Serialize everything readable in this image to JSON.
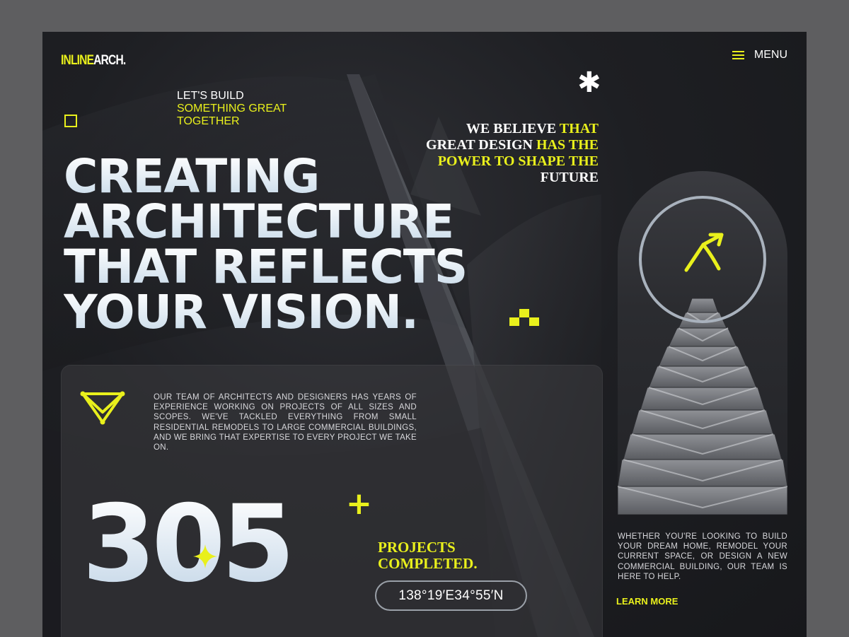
{
  "brand": {
    "logo_part1": "INLINE",
    "logo_part2": "ARCH."
  },
  "nav": {
    "menu_label": "MENU"
  },
  "tagline": {
    "line1": "LET'S BUILD",
    "line2": "SOMETHING GREAT",
    "line3": "TOGETHER"
  },
  "belief": {
    "p1": "WE BELIEVE ",
    "p2": "THAT",
    "p3": "GREAT DESIGN ",
    "p4": "HAS THE",
    "p5": "POWER TO SHAPE THE",
    "p6": "FUTURE"
  },
  "hero": {
    "lines": [
      "CREATING",
      "ARCHITECTURE",
      "THAT REFLECTS",
      "YOUR VISION."
    ]
  },
  "about": {
    "text": "OUR TEAM OF ARCHITECTS AND DESIGNERS HAS YEARS OF EXPERIENCE WORKING ON PROJECTS OF ALL SIZES AND SCOPES. WE'VE TACKLED EVERYTHING FROM SMALL RESIDENTIAL REMODELS TO LARGE COMMERCIAL BUILDINGS, AND WE BRING THAT EXPERTISE TO EVERY PROJECT WE TAKE ON."
  },
  "stats": {
    "count": "305",
    "plus": "+",
    "label_line1": "PROJECTS",
    "label_line2": "COMPLETED."
  },
  "coordinates": {
    "text": "138°19′E34°55′N"
  },
  "help": {
    "text": "WHETHER YOU'RE LOOKING TO BUILD YOUR DREAM HOME, REMODEL YOUR CURRENT SPACE, OR DESIGN A NEW COMMERCIAL BUILDING, OUR TEAM IS HERE TO HELP.",
    "cta": "LEARN MORE"
  },
  "colors": {
    "accent": "#e9f01c",
    "background": "#1e1f23",
    "text": "#ffffff"
  },
  "icons": [
    "hamburger-icon",
    "asterisk-icon",
    "square-icon",
    "checker-icon",
    "triangle-badge-icon",
    "sparkle-star-icon",
    "arrow-up-right-icon"
  ]
}
